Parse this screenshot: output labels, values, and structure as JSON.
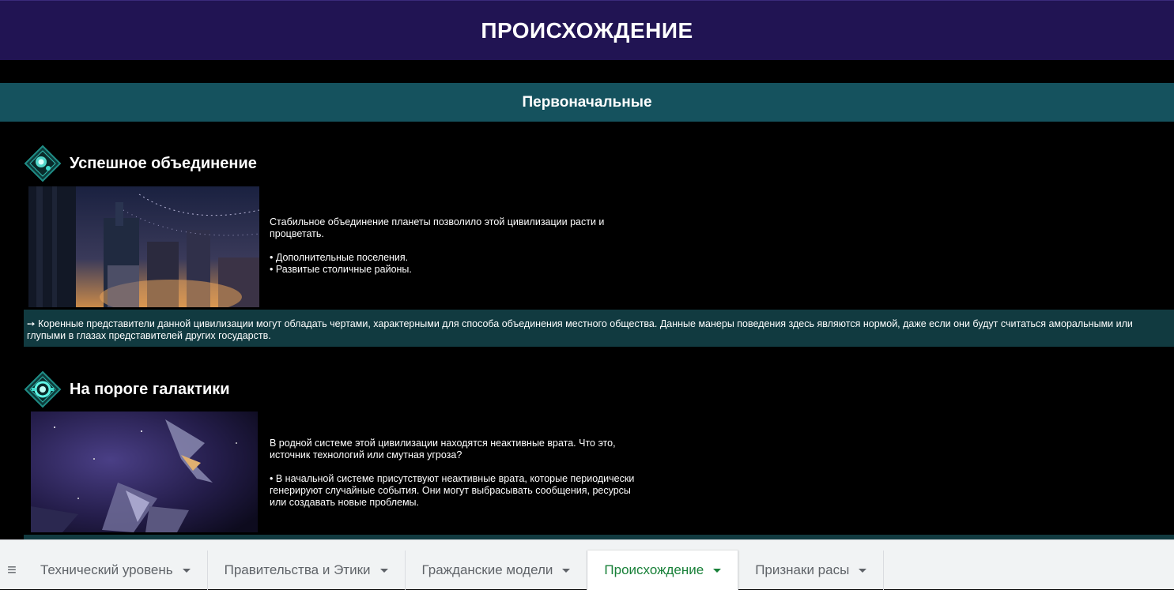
{
  "header": {
    "title": "ПРОИСХОЖДЕНИЕ"
  },
  "section": {
    "title": "Первоначальные"
  },
  "origins": [
    {
      "name": "Успешное объединение",
      "icon": "diamond-planet-icon",
      "image": "city-skyline-image",
      "desc_line1": "Стабильное объединение планеты позволило этой цивилизации расти и процветать.",
      "bullet1": "• Дополнительные поселения.",
      "bullet2": "• Развитые столичные районы.",
      "note": "➙ Коренные представители данной цивилизации могут обладать чертами, характерными для способа объединения местного общества. Данные манеры поведения здесь являются нормой, даже если они будут считаться аморальными или глупыми в глазах представителей других государств."
    },
    {
      "name": "На пороге галактики",
      "icon": "diamond-gate-icon",
      "image": "space-ships-image",
      "desc_line1": "В родной системе этой цивилизации находятся неактивные врата. Что это, источник технологий или смутная угроза?",
      "bullet1": "• В начальной системе присутствуют неактивные врата, которые периодически генерируют случайные события. Они могут выбрасывать сообщения, ресурсы или создавать новые проблемы."
    }
  ],
  "tabs": [
    {
      "label": "Технический уровень",
      "active": false
    },
    {
      "label": "Правительства и Этики",
      "active": false
    },
    {
      "label": "Гражданские модели",
      "active": false
    },
    {
      "label": "Происхождение",
      "active": true
    },
    {
      "label": "Признаки расы",
      "active": false
    }
  ],
  "colors": {
    "header_bg": "#211453",
    "section_bg": "#15525e",
    "note_bg": "#113a40",
    "active_tab": "#188038"
  }
}
